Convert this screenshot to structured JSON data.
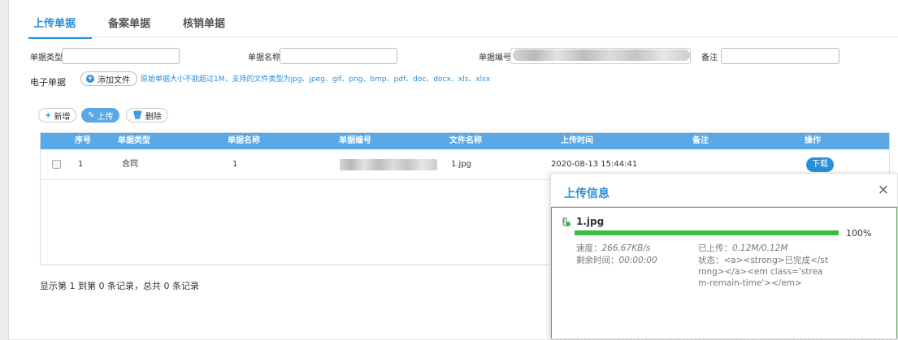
{
  "tabs": [
    {
      "label": "上传单据",
      "active": true
    },
    {
      "label": "备案单据",
      "active": false
    },
    {
      "label": "核销单据",
      "active": false
    }
  ],
  "filters": {
    "doc_type_label": "单据类型",
    "doc_name_label": "单据名称",
    "doc_no_label": "单据编号",
    "remark_label": "备注"
  },
  "edoc": {
    "label": "电子单据",
    "add_file_label": "添加文件",
    "hint": "原始单据大小不能超过1M，支持的文件类型为jpg、jpeg、gif、png、bmp、pdf、doc、docx、xls、xlsx"
  },
  "toolbar": {
    "new_label": "新增",
    "upload_label": "上传",
    "delete_label": "删除"
  },
  "table": {
    "headers": [
      "序号",
      "单据类型",
      "单据名称",
      "单据编号",
      "文件名称",
      "上传时间",
      "备注",
      "操作"
    ],
    "rows": [
      {
        "index": "1",
        "type": "合同",
        "name": "1",
        "doc_no": "",
        "file": "1.jpg",
        "time": "2020-08-13 15:44:41",
        "remark": "",
        "action": "下载"
      }
    ]
  },
  "pagination": {
    "summary": "显示第 1 到第 0 条记录，总共 0 条记录"
  },
  "upload_dialog": {
    "title": "上传信息",
    "close": "×",
    "file_name": "1.jpg",
    "progress_percent": 100,
    "progress_label": "100%",
    "speed_label": "速度：",
    "speed_value": "266.67KB/s",
    "remain_label": "剩余时间：",
    "remain_value": "00:00:00",
    "uploaded_label": "已上传：",
    "uploaded_value": "0.12M/0.12M",
    "status_text": "状态：<a><strong>已完成</strong></a><em class='stream-remain-time'></em>"
  },
  "colors": {
    "accent": "#2a8fd8",
    "table_header": "#5aa9e6",
    "progress": "#3dbb3d"
  }
}
